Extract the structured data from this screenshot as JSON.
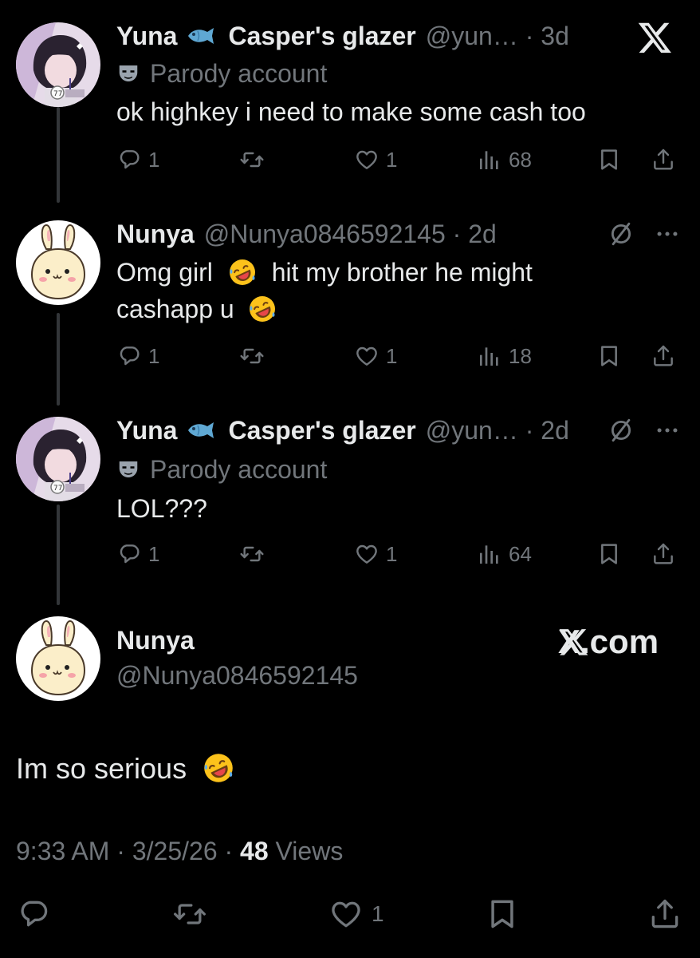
{
  "brand_logo": "X",
  "brand_text": "X.com",
  "tweets": [
    {
      "name": "Yuna",
      "name_suffix": "Casper's glazer",
      "handle": "@yun…",
      "time": "3d",
      "parody": "Parody account",
      "text": "ok highkey i need to make some cash too",
      "replies": "1",
      "likes": "1",
      "views": "68"
    },
    {
      "name": "Nunya",
      "handle": "@Nunya0846592145",
      "time": "2d",
      "text_line1_a": "Omg girl",
      "text_line1_b": "hit my brother he might",
      "text_line2": "cashapp u",
      "replies": "1",
      "likes": "1",
      "views": "18"
    },
    {
      "name": "Yuna",
      "name_suffix": "Casper's glazer",
      "handle": "@yun…",
      "time": "2d",
      "parody": "Parody account",
      "text": "LOL???",
      "replies": "1",
      "likes": "1",
      "views": "64"
    }
  ],
  "main": {
    "name": "Nunya",
    "handle": "@Nunya0846592145",
    "text": "Im so serious",
    "time": "9:33 AM",
    "date": "3/25/26",
    "views_count": "48",
    "views_label": "Views",
    "likes": "1"
  },
  "colors": {
    "background": "#000000",
    "text_primary": "#e7e9ea",
    "text_secondary": "#71767b",
    "thread_line": "#333639"
  }
}
